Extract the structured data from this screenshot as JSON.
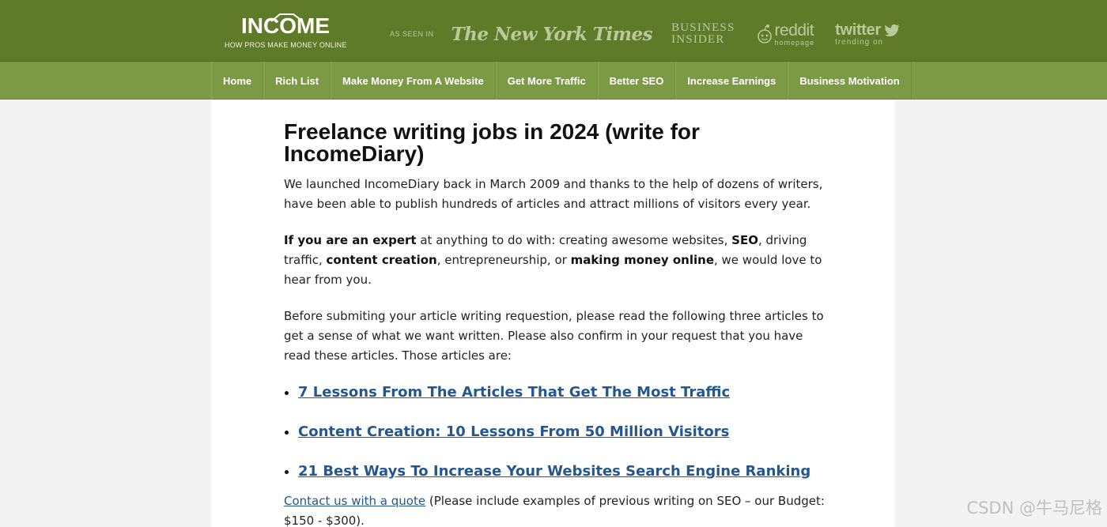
{
  "header": {
    "logo": {
      "word": "INCOME",
      "tagline": "HOW PROS MAKE MONEY ONLINE"
    },
    "as_seen_in": "AS SEEN IN",
    "press": {
      "nyt": "The New York Times",
      "bi_line1": "BUSINESS",
      "bi_line2": "INSIDER",
      "reddit_word": "reddit",
      "reddit_sub": "homepage",
      "twitter_word": "twitter",
      "twitter_sub": "trending on"
    },
    "colors": {
      "header_bg": "#5f7b29",
      "nav_bg": "#7c9a43",
      "link": "#24578f"
    }
  },
  "nav": {
    "items": [
      {
        "label": "Home"
      },
      {
        "label": "Rich List"
      },
      {
        "label": "Make Money From A Website"
      },
      {
        "label": "Get More Traffic"
      },
      {
        "label": "Better SEO"
      },
      {
        "label": "Increase Earnings"
      },
      {
        "label": "Business Motivation"
      }
    ]
  },
  "article": {
    "title": "Freelance writing jobs in 2024 (write for IncomeDiary)",
    "p1": "We launched IncomeDiary back in March 2009 and thanks to the help of dozens of writers, have been able to publish hundreds of articles and attract millions of visitors every year.",
    "p2": {
      "b1": "If you are an expert",
      "t1": " at anything to do with: creating awesome websites, ",
      "b2": "SEO",
      "t2": ", driving traffic, ",
      "b3": "content creation",
      "t3": ", entrepreneurship, or ",
      "b4": "making money online",
      "t4": ", we would love to hear from you."
    },
    "p3": "Before submiting your article writing requestion, please read the following three articles to get a sense of what we want written. Please also confirm in your request that you have read these articles. Those articles are:",
    "links": [
      {
        "label": "7 Lessons From The Articles That Get The Most Traffic"
      },
      {
        "label": "Content Creation: 10 Lessons From 50 Million Visitors"
      },
      {
        "label": "21 Best Ways To Increase Your Websites Search Engine Ranking"
      }
    ],
    "contact_link": "Contact us with a quote",
    "contact_text": " (Please include examples of previous writing on SEO – our Budget: $150 - $300)."
  },
  "watermark": "CSDN @牛马尼格"
}
